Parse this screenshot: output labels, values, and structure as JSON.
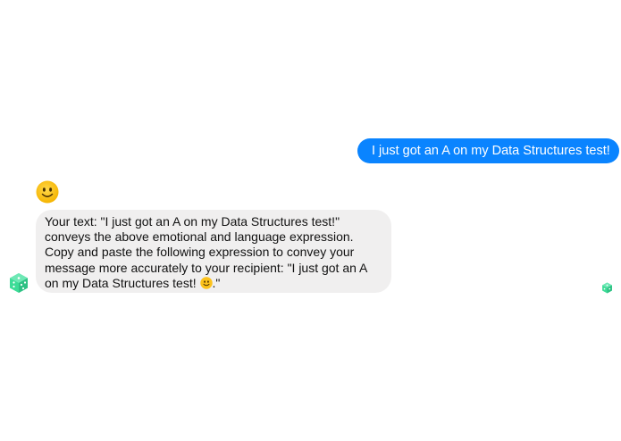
{
  "conversation": {
    "outgoing_message": "I just got an A on my Data Structures test!",
    "reaction_emoji_icon": "slightly-smiling-face-emoji",
    "incoming_message": {
      "before_emoji": "Your text: \"I just got an A on my Data Structures test!\" conveys the above emotional and language expression. Copy and paste the following expression to convey your message more accurately to your recipient: \"I just got an A on my Data Structures test! ",
      "inline_emoji_icon": "slightly-smiling-face-emoji",
      "after_emoji": ".\""
    },
    "bot_avatar_icon": "green-dice-bot-avatar",
    "read_indicator_icon": "green-dice-read-receipt"
  },
  "colors": {
    "outgoing_bubble": "#0a84ff",
    "incoming_bubble": "#f0efef",
    "emoji_yellow": "#fcc21b",
    "avatar_green": "#3ddc97"
  }
}
